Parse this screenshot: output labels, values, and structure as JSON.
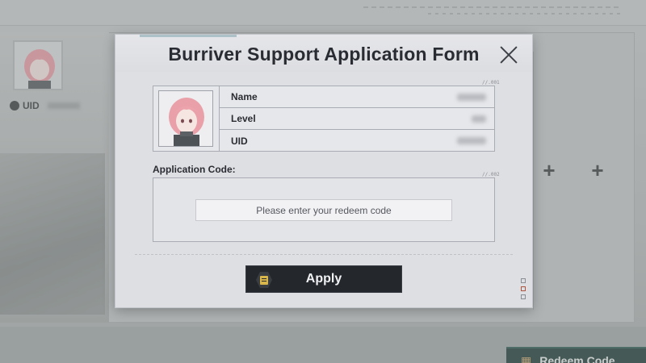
{
  "background": {
    "uid_label": "UID",
    "redeem_button_label": "Redeem Code",
    "plus_symbol": "+"
  },
  "modal": {
    "title": "Burriver Support Application Form",
    "info_tag": "//.001",
    "code_tag": "//.002",
    "fields": [
      {
        "label": "Name"
      },
      {
        "label": "Level"
      },
      {
        "label": "UID"
      }
    ],
    "code_label": "Application Code:",
    "code_placeholder": "Please enter your redeem code",
    "apply_label": "Apply"
  },
  "colors": {
    "apply_bg": "#24272c",
    "apply_icon": "#d9b64c",
    "redeem_bg": "#1f3c37",
    "title_text": "#2a2c33"
  },
  "icons": {
    "close": "close-icon",
    "apply": "document-icon",
    "gift": "gift-icon",
    "uid": "uid-badge-icon"
  }
}
